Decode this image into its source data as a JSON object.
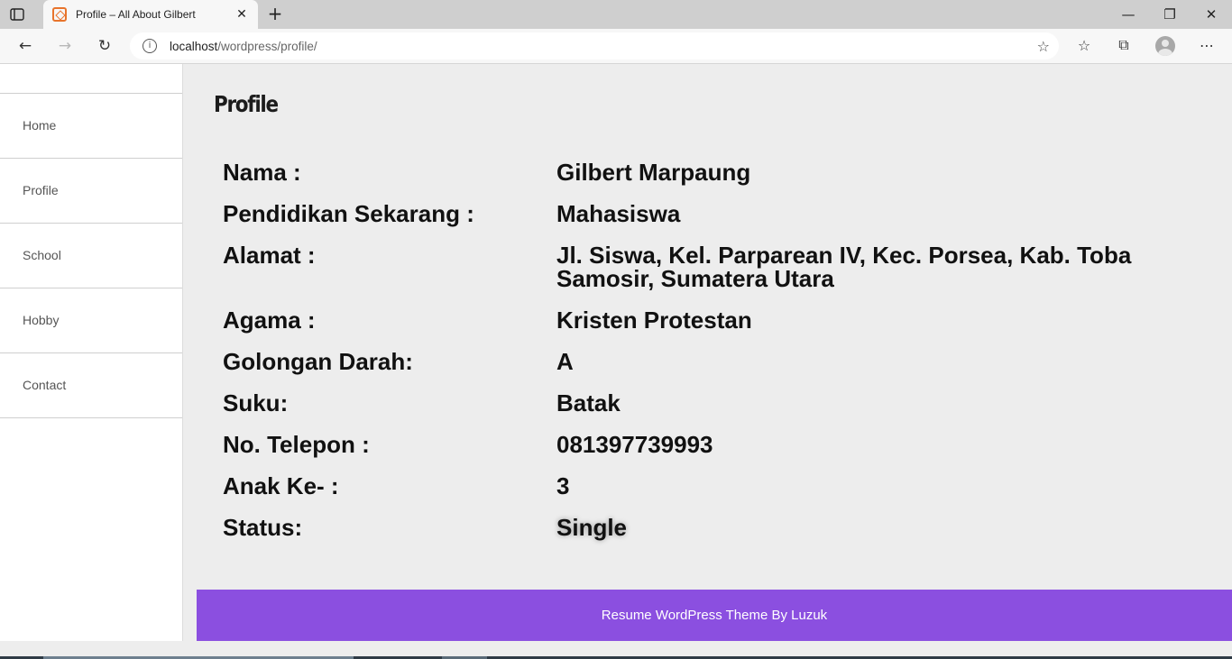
{
  "browser": {
    "tab_title": "Profile – All About Gilbert",
    "url_host": "localhost",
    "url_path": "/wordpress/profile/"
  },
  "sidebar": {
    "items": [
      {
        "label": "Home"
      },
      {
        "label": "Profile"
      },
      {
        "label": "School"
      },
      {
        "label": "Hobby"
      },
      {
        "label": "Contact"
      }
    ]
  },
  "main": {
    "title": "Profile",
    "rows": [
      {
        "label": "Nama :",
        "value": "Gilbert Marpaung"
      },
      {
        "label": "Pendidikan Sekarang :",
        "value": "Mahasiswa"
      },
      {
        "label": "Alamat :",
        "value": "Jl. Siswa, Kel. Parparean IV, Kec. Porsea, Kab. Toba Samosir, Sumatera Utara"
      },
      {
        "label": "Agama :",
        "value": "Kristen Protestan"
      },
      {
        "label": "Golongan Darah:",
        "value": "A"
      },
      {
        "label": "Suku:",
        "value": "Batak"
      },
      {
        "label": "No. Telepon :",
        "value": "081397739993"
      },
      {
        "label": "Anak Ke- :",
        "value": "3"
      },
      {
        "label": "Status:",
        "value": "Single"
      }
    ]
  },
  "footer": {
    "text": "Resume WordPress Theme By Luzuk"
  },
  "colors": {
    "footer_bg": "#8b4fe0",
    "page_bg": "#ededed"
  }
}
